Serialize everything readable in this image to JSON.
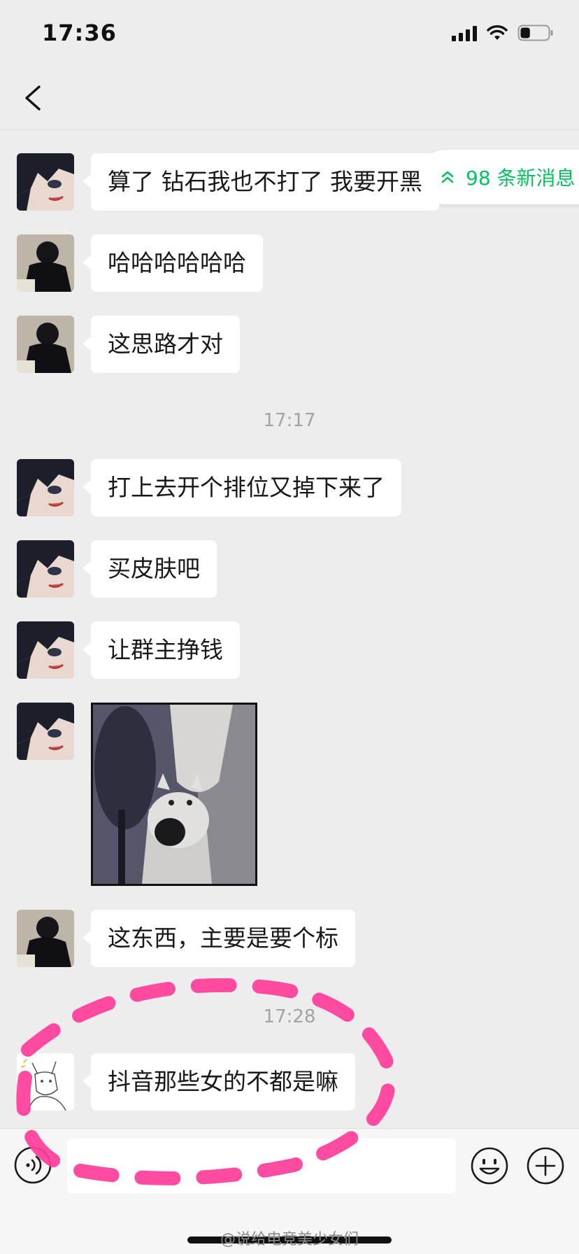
{
  "status_bar": {
    "time": "17:36",
    "battery_level": 0.35
  },
  "new_messages": {
    "label": "98 条新消息"
  },
  "messages": [
    {
      "text": "算了 钻石我也不打了 我要开黑"
    },
    {
      "text": "哈哈哈哈哈哈"
    },
    {
      "text": "这思路才对"
    },
    {
      "text": "打上去开个排位又掉下来了"
    },
    {
      "text": "买皮肤吧"
    },
    {
      "text": "让群主挣钱"
    },
    {
      "text": "这东西，主要是要个标"
    },
    {
      "text": "抖音那些女的不都是嘛"
    }
  ],
  "timestamps": [
    "17:17",
    "17:28"
  ],
  "input": {
    "value": "",
    "placeholder": ""
  },
  "watermark": "@说给电竞美少女们",
  "colors": {
    "background": "#ededed",
    "bubble": "#ffffff",
    "accent": "#07c160",
    "annotation": "#ff3d9a"
  },
  "icons": {
    "back": "chevron-left-icon",
    "new_messages": "double-chevron-up-icon",
    "voice": "voice-icon",
    "emoji": "emoji-icon",
    "plus": "plus-icon"
  }
}
